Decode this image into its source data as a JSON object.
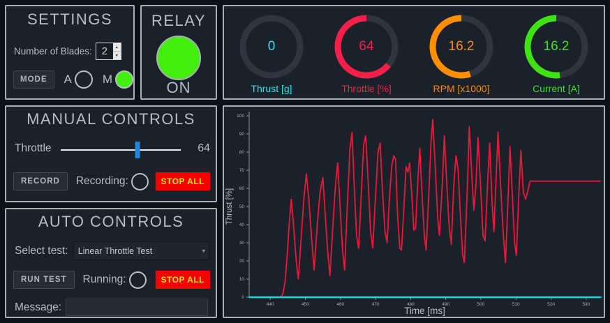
{
  "colors": {
    "relay_green": "#43ee0e",
    "slider_blue": "#1e86e0",
    "stop_all_bg": "#f50000",
    "stop_all_text": "#ffe600",
    "panel_border": "#a9afb5",
    "text_gray": "#b7bdc4"
  },
  "settings": {
    "title": "SETTINGS",
    "blades_label": "Number of Blades:",
    "blades_value": "2",
    "mode_button": "MODE",
    "mode_a_label": "A",
    "mode_m_label": "M",
    "mode_selected": "M"
  },
  "relay": {
    "title": "RELAY",
    "state": "ON"
  },
  "gauges": [
    {
      "value": "0",
      "label": "Thrust [g]",
      "color": "#2be4ea",
      "frac": 0.0
    },
    {
      "value": "64",
      "label": "Throttle [%]",
      "color": "#f5204a",
      "frac": 0.64
    },
    {
      "value": "16.2",
      "label": "RPM [x1000]",
      "color": "#ff8e01",
      "frac": 0.55
    },
    {
      "value": "16.2",
      "label": "Current [A]",
      "color": "#3fe315",
      "frac": 0.52
    }
  ],
  "manual": {
    "title": "MANUAL CONTROLS",
    "throttle_label": "Throttle",
    "throttle_value": "64",
    "slider_frac": 0.64,
    "record_button": "RECORD",
    "recording_label": "Recording:",
    "stop_all_button": "STOP ALL"
  },
  "auto": {
    "title": "AUTO CONTROLS",
    "select_label": "Select test:",
    "selected_test": "Linear Throttle Test",
    "run_button": "RUN TEST",
    "running_label": "Running:",
    "stop_all_button": "STOP ALL",
    "message_label": "Message:",
    "message_value": ""
  },
  "chart_data": {
    "type": "line",
    "title": "",
    "xlabel": "Time [ms]",
    "ylabel": "Thrust [%]",
    "xlim": [
      434,
      534
    ],
    "ylim": [
      0,
      100
    ],
    "x_ticks": [
      440,
      450,
      460,
      470,
      480,
      490,
      500,
      510,
      520,
      530
    ],
    "y_ticks": [
      0,
      10,
      20,
      30,
      40,
      50,
      60,
      70,
      80,
      90,
      100
    ],
    "grid": false,
    "legend": false,
    "series": [
      {
        "color": "#f01638",
        "width": 1.8,
        "points": [
          [
            443,
            0
          ],
          [
            443.6,
            2
          ],
          [
            444.2,
            8
          ],
          [
            444.8,
            22
          ],
          [
            445.4,
            40
          ],
          [
            446,
            54
          ],
          [
            446.7,
            38
          ],
          [
            447.4,
            20
          ],
          [
            448,
            10
          ],
          [
            448.8,
            32
          ],
          [
            449.6,
            55
          ],
          [
            450.3,
            68
          ],
          [
            451,
            54
          ],
          [
            451.8,
            32
          ],
          [
            452.5,
            15
          ],
          [
            453.4,
            40
          ],
          [
            454.2,
            58
          ],
          [
            455,
            66
          ],
          [
            455.7,
            44
          ],
          [
            456.4,
            24
          ],
          [
            457,
            12
          ],
          [
            457.8,
            38
          ],
          [
            458.6,
            62
          ],
          [
            459.2,
            74
          ],
          [
            460,
            46
          ],
          [
            460.6,
            26
          ],
          [
            461.2,
            15
          ],
          [
            462,
            52
          ],
          [
            462.7,
            82
          ],
          [
            463.3,
            91
          ],
          [
            464,
            58
          ],
          [
            464.6,
            34
          ],
          [
            465.2,
            27
          ],
          [
            466,
            60
          ],
          [
            466.6,
            84
          ],
          [
            467.2,
            89
          ],
          [
            468,
            60
          ],
          [
            468.6,
            36
          ],
          [
            469.2,
            27
          ],
          [
            470,
            56
          ],
          [
            470.7,
            80
          ],
          [
            471.3,
            85
          ],
          [
            472,
            58
          ],
          [
            472.7,
            36
          ],
          [
            473.3,
            30
          ],
          [
            474,
            56
          ],
          [
            474.6,
            72
          ],
          [
            475.2,
            78
          ],
          [
            475.7,
            76
          ],
          [
            476.3,
            44
          ],
          [
            476.9,
            27
          ],
          [
            477.4,
            26
          ],
          [
            478.1,
            50
          ],
          [
            478.7,
            72
          ],
          [
            479.2,
            69
          ],
          [
            479.7,
            74
          ],
          [
            480.4,
            54
          ],
          [
            480.9,
            37
          ],
          [
            481.4,
            38
          ],
          [
            482.1,
            66
          ],
          [
            482.6,
            82
          ],
          [
            483.3,
            54
          ],
          [
            483.9,
            34
          ],
          [
            484.4,
            26
          ],
          [
            485.2,
            58
          ],
          [
            485.8,
            86
          ],
          [
            486.3,
            98
          ],
          [
            487.1,
            68
          ],
          [
            487.7,
            44
          ],
          [
            488.2,
            34
          ],
          [
            489,
            62
          ],
          [
            489.6,
            89
          ],
          [
            490.3,
            62
          ],
          [
            491,
            38
          ],
          [
            491.6,
            29
          ],
          [
            492.3,
            62
          ],
          [
            492.9,
            78
          ],
          [
            493.5,
            71
          ],
          [
            494.2,
            44
          ],
          [
            494.8,
            24
          ],
          [
            495.3,
            19
          ],
          [
            496.1,
            58
          ],
          [
            496.7,
            94
          ],
          [
            497.4,
            68
          ],
          [
            498,
            48
          ],
          [
            498.6,
            62
          ],
          [
            499.2,
            88
          ],
          [
            500,
            58
          ],
          [
            500.6,
            34
          ],
          [
            501.2,
            31
          ],
          [
            501.9,
            62
          ],
          [
            502.5,
            85
          ],
          [
            503.2,
            52
          ],
          [
            503.7,
            36
          ],
          [
            504.3,
            64
          ],
          [
            504.9,
            91
          ],
          [
            505.7,
            58
          ],
          [
            506.4,
            34
          ],
          [
            507,
            19
          ],
          [
            507.7,
            52
          ],
          [
            508.3,
            83
          ],
          [
            509,
            54
          ],
          [
            509.6,
            30
          ],
          [
            510.1,
            23
          ],
          [
            510.8,
            56
          ],
          [
            511.4,
            81
          ],
          [
            512.1,
            58
          ],
          [
            512.7,
            54
          ],
          [
            513.3,
            58
          ],
          [
            514,
            64
          ],
          [
            534,
            64
          ]
        ]
      },
      {
        "color": "#00dede",
        "width": 2.5,
        "points": [
          [
            434,
            0
          ],
          [
            534,
            0
          ]
        ]
      }
    ]
  }
}
